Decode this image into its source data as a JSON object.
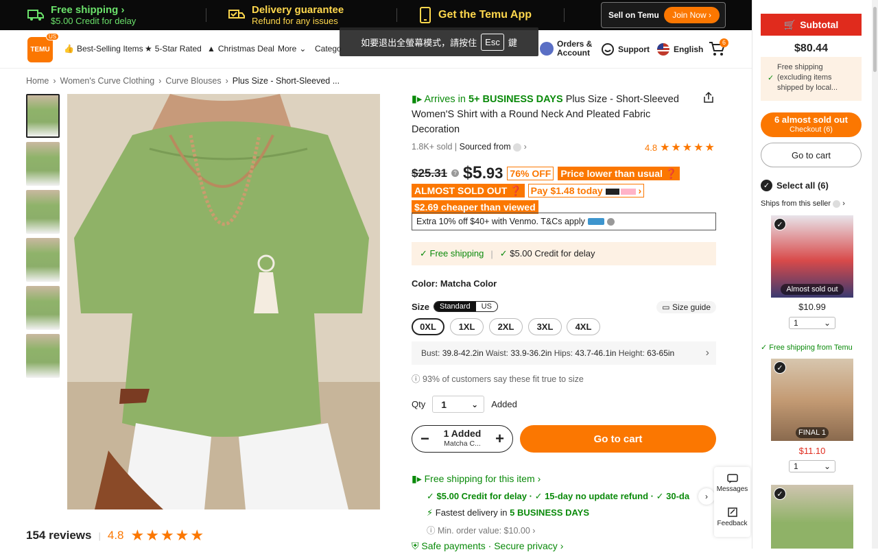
{
  "banner": {
    "free_shipping_title": "Free shipping",
    "free_shipping_sub": "$5.00 Credit for delay",
    "delivery_title": "Delivery guarantee",
    "delivery_sub": "Refund for any issues",
    "app_title": "Get the Temu App",
    "sell_label": "Sell on Temu",
    "join_label": "Join Now"
  },
  "header": {
    "logo_text": "TEMU",
    "logo_badge": "US",
    "nav": [
      "Best-Selling Items",
      "5-Star Rated",
      "Christmas Deal",
      "More",
      "Catego"
    ],
    "orders_label_1": "Orders &",
    "orders_label_2": "Account",
    "support_label": "Support",
    "language_label": "English",
    "cart_count": "6"
  },
  "toast": {
    "text_before": "如要退出全螢幕模式，請按住",
    "key": "Esc",
    "text_after": "鍵"
  },
  "breadcrumb": [
    "Home",
    "Women's Curve Clothing",
    "Curve Blouses",
    "Plus Size - Short-Sleeved ..."
  ],
  "product": {
    "arrives_prefix": "Arrives in",
    "arrives_days": "5+ BUSINESS DAYS",
    "title": "Plus Size - Short-Sleeved Women'S Shirt with a Round Neck And Pleated Fabric Decoration",
    "sold": "1.8K+ sold",
    "sourced_from": "Sourced from",
    "rating": "4.8",
    "old_price": "$25.31",
    "price_whole": "$5",
    "price_cents": ".93",
    "discount": "76% OFF",
    "lower_tag": "Price lower than usual",
    "almost_sold": "ALMOST SOLD OUT",
    "pay_later": "Pay $1.48 today",
    "cheaper_tag": "$2.69 cheaper than viewed",
    "venmo_text": "Extra 10% off $40+ with Venmo. T&Cs apply",
    "free_shipping": "Free shipping",
    "credit_delay": "$5.00 Credit for delay",
    "color_label": "Color: Matcha Color",
    "size_label": "Size",
    "unit_standard": "Standard",
    "unit_us": "US",
    "size_guide": "Size guide",
    "sizes": [
      "0XL",
      "1XL",
      "2XL",
      "3XL",
      "4XL"
    ],
    "fit_bust_k": "Bust:",
    "fit_bust_v": "39.8-42.2in",
    "fit_waist_k": "Waist:",
    "fit_waist_v": "33.9-36.2in",
    "fit_hips_k": "Hips:",
    "fit_hips_v": "43.7-46.1in",
    "fit_height_k": "Height:",
    "fit_height_v": "63-65in",
    "fit_pct": "93% of customers say these fit true to size",
    "qty_label": "Qty",
    "qty_value": "1",
    "added_label": "Added",
    "stepper_top": "1 Added",
    "stepper_bottom": "Matcha C...",
    "go_to_cart": "Go to cart",
    "ship_item": "Free shipping for this item",
    "ship_credit": "$5.00 Credit for delay",
    "ship_refund": "15-day no update refund",
    "ship_30": "30-da",
    "fastest_prefix": "Fastest delivery in",
    "fastest_days": "5 BUSINESS DAYS",
    "min_order": "Min. order value: $10.00",
    "safe_pay": "Safe payments · Secure privacy"
  },
  "reviews": {
    "count": "154 reviews",
    "rating": "4.8"
  },
  "widgets": {
    "messages": "Messages",
    "feedback": "Feedback"
  },
  "cart": {
    "subtotal_label": "Subtotal",
    "subtotal_value": "$80.44",
    "free_text": "Free shipping (excluding items shipped by local...",
    "checkout_top": "6 almost sold out",
    "checkout_bottom": "Checkout (6)",
    "go_to_cart": "Go to cart",
    "select_all": "Select all (6)",
    "ships_from": "Ships from this seller",
    "free_from_temu": "Free shipping from Temu",
    "items": [
      {
        "label": "Almost sold out",
        "price": "$10.99",
        "qty": "1"
      },
      {
        "label": "FINAL 1",
        "price": "$11.10",
        "qty": "1"
      }
    ]
  },
  "colors": {
    "brand_orange": "#fb7701",
    "green": "#0a8a0a",
    "subtotal_red": "#e02b1d"
  }
}
